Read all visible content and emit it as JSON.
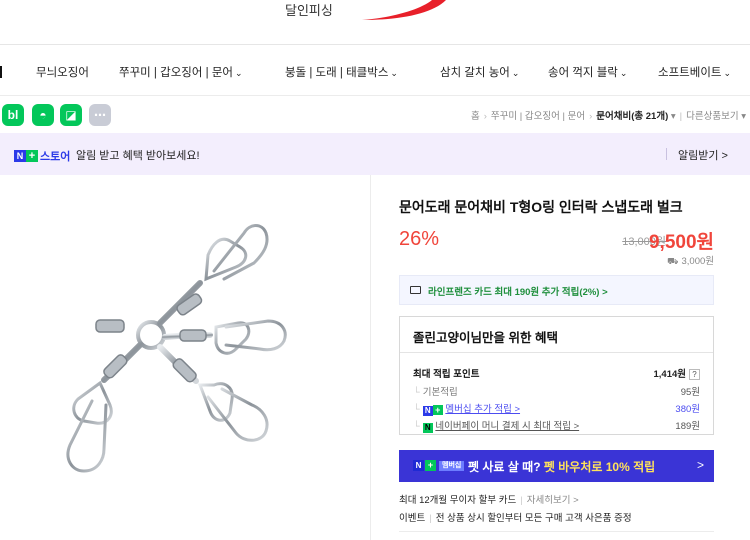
{
  "store": {
    "name": "달인피싱"
  },
  "nav": {
    "items": [
      {
        "label": "무늬오징어",
        "chevron": false
      },
      {
        "label": "쭈꾸미 | 갑오징어 | 문어",
        "chevron": true
      },
      {
        "label": "붕돌 | 도래 | 태클박스",
        "chevron": true
      },
      {
        "label": "삼치 갈치 농어",
        "chevron": true
      },
      {
        "label": "송어 꺽지 블락",
        "chevron": true
      },
      {
        "label": "소프트베이트",
        "chevron": true
      }
    ],
    "chevron_glyph": "⌄"
  },
  "share": {
    "buttons": [
      {
        "label": "bl",
        "icon": "blog-icon",
        "color": "#03c75a"
      },
      {
        "label": "◓",
        "icon": "talk-icon",
        "color": "#03c75a"
      },
      {
        "label": "◪",
        "icon": "bookmark-icon",
        "color": "#03c75a"
      },
      {
        "label": "⋯",
        "icon": "more-icon",
        "color": "#c9ccd6"
      }
    ]
  },
  "breadcrumb": {
    "home": "홈",
    "level1": "쭈꾸미 | 갑오징어 | 문어",
    "level2": "문어채비",
    "count": "(총 21개)",
    "other": "다른상품보기"
  },
  "banner": {
    "n": "N",
    "plus": "+",
    "store_label": "스토어",
    "text": "알림 받고 혜택 받아보세요!",
    "button": "알림받기 >"
  },
  "product": {
    "title": "문어도래 문어채비 T형O링 인터락 스냅도래 벌크",
    "discount": "26%",
    "original_price": "13,000원",
    "sale_price": "9,500원",
    "shipping": "3,000원",
    "card_benefit": "라인프렌즈 카드 최대 190원 추가 적립(2%) >"
  },
  "benefit": {
    "title": "졸린고양이님만을 위한 혜택",
    "max_points_label": "최대 적립 포인트",
    "max_points_value": "1,414원",
    "question": "?",
    "rows": [
      {
        "label": "기본적립",
        "value": "95원",
        "tag": "none",
        "color": "#777"
      },
      {
        "label": "멤버십 추가 적립 >",
        "value": "380원",
        "tag": "membership",
        "color": "#4b4cf0"
      },
      {
        "label": "네이버페이 머니 결제 시 최대 적립 >",
        "value": "189원",
        "tag": "pay",
        "color": "#555"
      }
    ]
  },
  "membership": {
    "badge": "멤버십",
    "text_before": "펫 사료 살 때?",
    "text_highlight": "펫 바우처로 10% 적립",
    "arrow": ">"
  },
  "install": {
    "text": "최대 12개월 무이자 할부 카드",
    "detail": "자세히보기 >"
  },
  "event": {
    "label": "이벤트",
    "text": "전 상품 상시 할인부터 모든 구매 고객 사은품 증정"
  },
  "colors": {
    "accent_red": "#f0453b",
    "naver_green": "#03c75a",
    "purple": "#3a34d6"
  }
}
